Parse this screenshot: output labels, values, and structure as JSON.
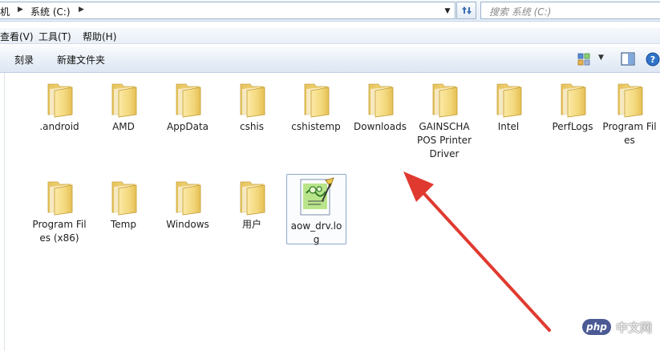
{
  "address": {
    "crumbs": [
      "机",
      "系统 (C:)"
    ],
    "search_placeholder": "搜索 系统 (C:)"
  },
  "menu": [
    "查看(V)",
    "工具(T)",
    "帮助(H)"
  ],
  "toolbar": {
    "burn_label": "刻录",
    "new_folder_label": "新建文件夹"
  },
  "items": [
    {
      "label": ".android",
      "type": "folder"
    },
    {
      "label": "AMD",
      "type": "folder"
    },
    {
      "label": "AppData",
      "type": "folder"
    },
    {
      "label": "cshis",
      "type": "folder"
    },
    {
      "label": "cshistemp",
      "type": "folder"
    },
    {
      "label": "Downloads",
      "type": "folder"
    },
    {
      "label": "GAINSCHA POS Printer Driver",
      "type": "folder"
    },
    {
      "label": "Intel",
      "type": "folder"
    },
    {
      "label": "PerfLogs",
      "type": "folder"
    },
    {
      "label": "Program Files",
      "type": "folder"
    },
    {
      "label": "Program Files (x86)",
      "type": "folder"
    },
    {
      "label": "Temp",
      "type": "folder"
    },
    {
      "label": "Windows",
      "type": "folder"
    },
    {
      "label": "用户",
      "type": "folder"
    },
    {
      "label": "aow_drv.log",
      "type": "log-file"
    }
  ],
  "watermark": {
    "logo": "php",
    "text": "中文网"
  },
  "colors": {
    "folder": "#f3d77b",
    "arrow": "#e03a30",
    "selection_border": "#8aa6c8"
  }
}
